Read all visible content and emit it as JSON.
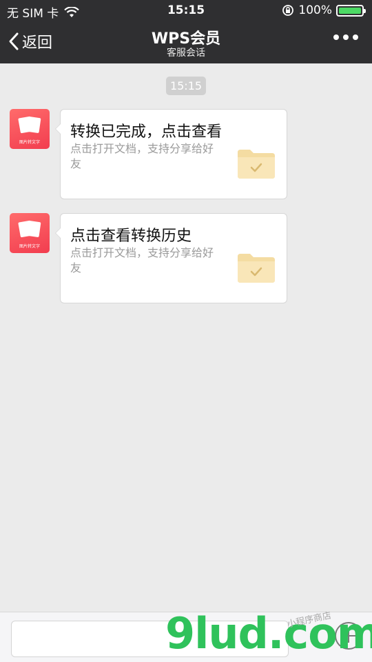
{
  "status_bar": {
    "carrier": "无 SIM 卡",
    "wifi_icon": "wifi-icon",
    "time": "15:15",
    "lock_icon": "rotation-lock-icon",
    "battery_percent": "100%",
    "battery_level": 1.0
  },
  "nav": {
    "back_label": "返回",
    "title": "WPS会员",
    "subtitle": "客服会话",
    "more_icon": "more-icon"
  },
  "chat": {
    "time_label": "15:15",
    "messages": [
      {
        "title": "转换已完成，点击查看",
        "desc": "点击打开文档，支持分享给好友",
        "avatar_caption": "图片转文字",
        "icon": "folder-check-icon"
      },
      {
        "title": "点击查看转换历史",
        "desc": "点击打开文档，支持分享给好友",
        "avatar_caption": "图片转文字",
        "icon": "folder-check-icon"
      }
    ]
  },
  "input_bar": {
    "placeholder": "",
    "plus_icon": "plus-icon"
  },
  "watermark": {
    "brand": "9lud",
    "suffix": ".com",
    "tag": "小程序商店"
  },
  "colors": {
    "nav_bg": "#2f2f31",
    "chat_bg": "#ebebeb",
    "avatar": "#f23d4f",
    "battery": "#4cd964",
    "watermark": "#2fc25b"
  }
}
